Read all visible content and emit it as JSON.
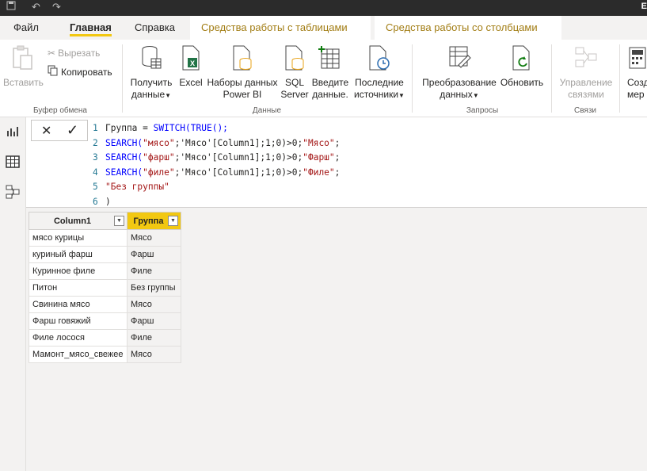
{
  "titlebar": {
    "right_letter": "E"
  },
  "tabs": {
    "file": "Файл",
    "home": "Главная",
    "help": "Справка",
    "table_tools": "Средства работы с таблицами",
    "column_tools": "Средства работы со столбцами"
  },
  "ribbon": {
    "clipboard": {
      "label": "Буфер обмена",
      "paste": "Вставить",
      "cut": "Вырезать",
      "copy": "Копировать"
    },
    "data": {
      "label": "Данные",
      "get_data": [
        "Получить",
        "данные"
      ],
      "excel": "Excel",
      "powerbi": [
        "Наборы данных",
        "Power BI"
      ],
      "sql": [
        "SQL",
        "Server"
      ],
      "enter": [
        "Введите",
        "данные."
      ],
      "recent": [
        "Последние",
        "источники"
      ]
    },
    "queries": {
      "label": "Запросы",
      "transform": [
        "Преобразование",
        "данных"
      ],
      "refresh": "Обновить"
    },
    "relationships": {
      "label": "Связи",
      "manage": [
        "Управление",
        "связями"
      ]
    },
    "calc": {
      "create": [
        "Созд",
        "мер"
      ]
    }
  },
  "formula": {
    "cancel": "✕",
    "commit": "✓",
    "lines": [
      {
        "n": "1",
        "parts": [
          {
            "t": "Группа = ",
            "c": "plain"
          },
          {
            "t": "SWITCH(TRUE();",
            "c": "kw"
          }
        ]
      },
      {
        "n": "2",
        "parts": [
          {
            "t": "SEARCH(",
            "c": "kw"
          },
          {
            "t": "\"мясо\"",
            "c": "str"
          },
          {
            "t": ";'Мясо'[Column1];1;0)>0;",
            "c": "plain"
          },
          {
            "t": "\"Мясо\"",
            "c": "str"
          },
          {
            "t": ";",
            "c": "plain"
          }
        ]
      },
      {
        "n": "3",
        "parts": [
          {
            "t": "SEARCH(",
            "c": "kw"
          },
          {
            "t": "\"фарш\"",
            "c": "str"
          },
          {
            "t": ";'Мясо'[Column1];1;0)>0;",
            "c": "plain"
          },
          {
            "t": "\"Фарш\"",
            "c": "str"
          },
          {
            "t": ";",
            "c": "plain"
          }
        ]
      },
      {
        "n": "4",
        "parts": [
          {
            "t": "SEARCH(",
            "c": "kw"
          },
          {
            "t": "\"филе\"",
            "c": "str"
          },
          {
            "t": ";'Мясо'[Column1];1;0)>0;",
            "c": "plain"
          },
          {
            "t": "\"Филе\"",
            "c": "str"
          },
          {
            "t": ";",
            "c": "plain"
          }
        ]
      },
      {
        "n": "5",
        "parts": [
          {
            "t": "\"Без группы\"",
            "c": "str"
          }
        ]
      },
      {
        "n": "6",
        "parts": [
          {
            "t": ")",
            "c": "plain"
          }
        ]
      }
    ]
  },
  "table": {
    "columns": [
      "Column1",
      "Группа"
    ],
    "rows": [
      [
        "мясо курицы",
        "Мясо"
      ],
      [
        "куриный фарш",
        "Фарш"
      ],
      [
        "Куринное филе",
        "Филе"
      ],
      [
        "Питон",
        "Без группы"
      ],
      [
        "Свинина мясо",
        "Мясо"
      ],
      [
        "Фарш говяжий",
        "Фарш"
      ],
      [
        "Филе лосося",
        "Филе"
      ],
      [
        "Мамонт_мясо_свежее",
        "Мясо"
      ]
    ]
  },
  "colors": {
    "accent": "#f2c811",
    "context_tab": "#a27d14",
    "keyword": "#0000ff",
    "string": "#a31515"
  }
}
